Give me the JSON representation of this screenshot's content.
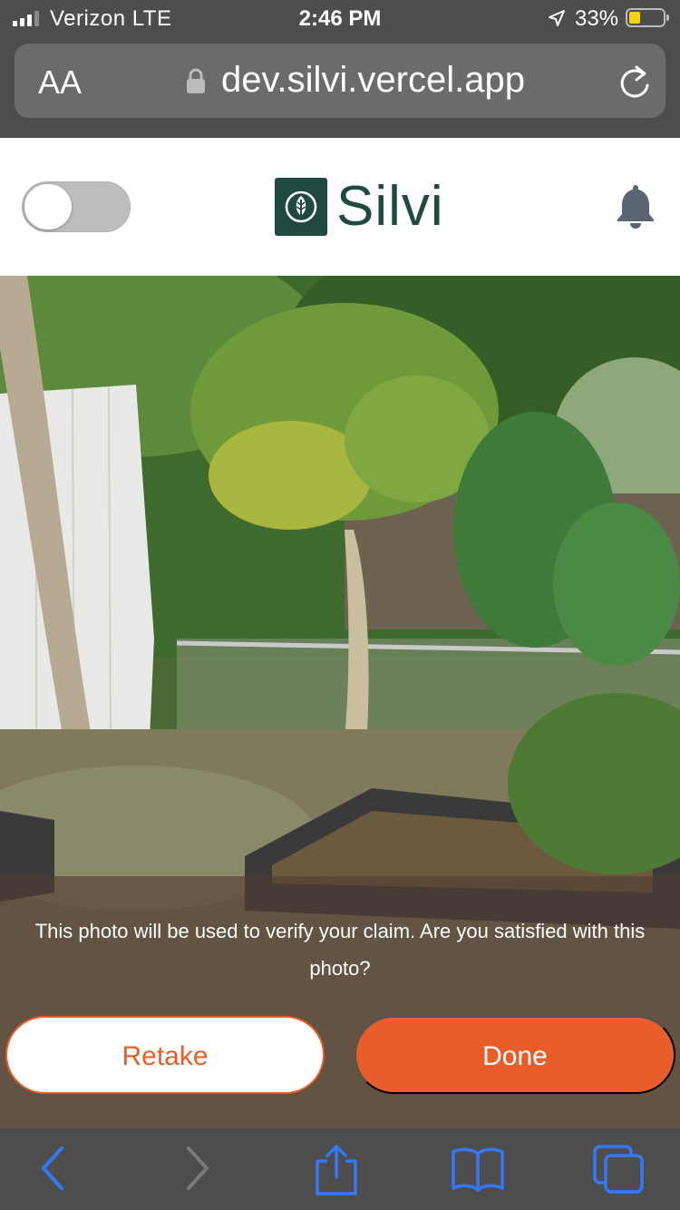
{
  "status_bar": {
    "carrier": "Verizon  LTE",
    "time": "2:46 PM",
    "battery_percent": "33%",
    "battery_level": 0.33,
    "icons": [
      "signal-icon",
      "location-arrow-icon",
      "battery-icon"
    ]
  },
  "browser": {
    "text_size_button": "AA",
    "url": "dev.silvi.vercel.app",
    "icons": [
      "lock-icon",
      "reload-icon"
    ]
  },
  "app_header": {
    "logo_text": "Silvi",
    "toggle_on": false,
    "icons": [
      "leaf-logo-icon",
      "bell-icon"
    ]
  },
  "photo": {
    "description_icon": "captured-photo"
  },
  "confirm_dialog": {
    "message": "This photo will be used to verify your claim. Are you satisfied with this photo?",
    "retake_label": "Retake",
    "done_label": "Done"
  },
  "toolbar": {
    "icons": [
      "back-icon",
      "forward-icon",
      "share-icon",
      "bookmarks-icon",
      "tabs-icon"
    ]
  },
  "colors": {
    "brand_green": "#1f4a40",
    "accent_orange": "#e85d2a",
    "ios_blue": "#3478f6"
  }
}
